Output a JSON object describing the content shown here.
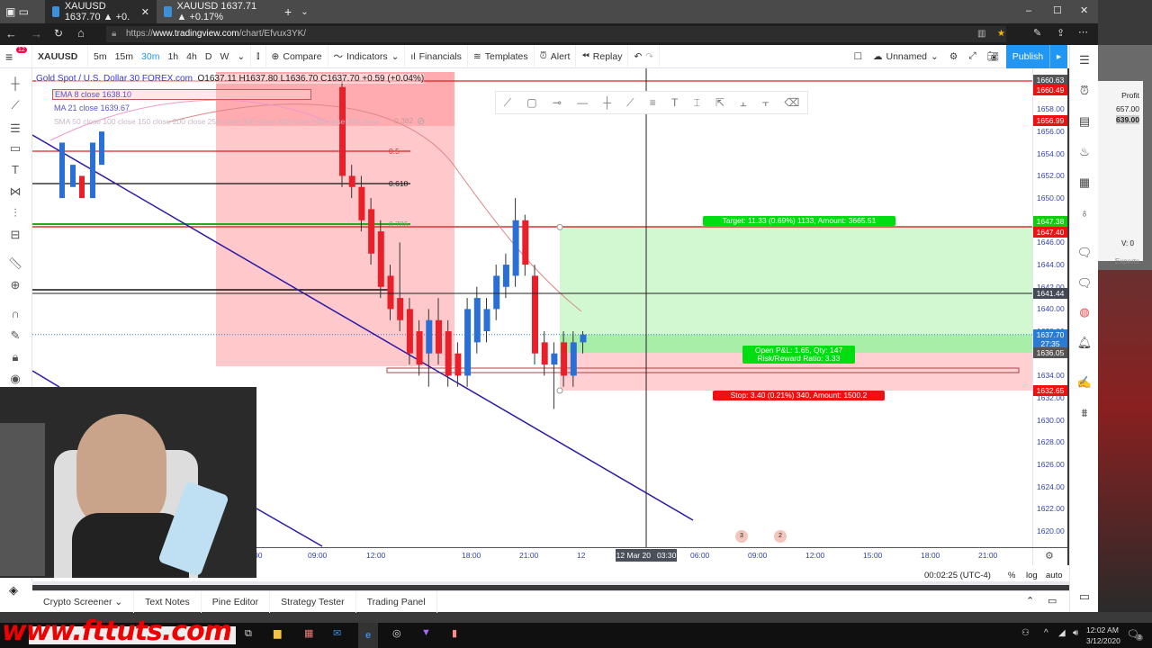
{
  "browser": {
    "tabs": [
      {
        "label": "XAUUSD 1637.70 ▲ +0.",
        "active": true
      },
      {
        "label": "XAUUSD 1637.71 ▲ +0.17%",
        "active": false
      }
    ],
    "url_prefix": "https://",
    "url_domain": "www.tradingview.com",
    "url_path": "/chart/Efvux3YK/"
  },
  "toolbar": {
    "symbol": "XAUUSD",
    "intervals": [
      "5m",
      "15m",
      "30m",
      "1h",
      "4h",
      "D",
      "W"
    ],
    "active_interval": "30m",
    "compare": "Compare",
    "indicators": "Indicators",
    "financials": "Financials",
    "templates": "Templates",
    "alert": "Alert",
    "replay": "Replay",
    "layout_name": "Unnamed",
    "publish": "Publish",
    "menu_badge": "12"
  },
  "legend": {
    "title": "Gold Spot / U.S. Dollar  30  FOREX.com",
    "ohlc": "O1637.11 H1637.80 L1636.70 C1637.70 +0.59 (+0.04%)",
    "ema": "EMA 8 close  1638.10",
    "ma": "MA 21 close  1639.67",
    "sma": "SMA 50 close 100 close 150 close 200 close 250 close 300 close 400 close 500 close 600 close"
  },
  "fib_labels": [
    "0.5",
    "0.618",
    "0.786",
    "0.382"
  ],
  "position": {
    "target": "Target: 11.33 (0.69%) 1133, Amount: 3665.51",
    "open_pnl": "Open P&L: 1.65, Qty: 147",
    "rr": "Risk/Reward Ratio: 3.33",
    "stop": "Stop: 3.40 (0.21%) 340, Amount: 1500.2",
    "entry": 1636.05,
    "target_price": 1647.38,
    "stop_price": 1632.65,
    "current": 1637.7
  },
  "price_axis": {
    "ticks": [
      "1658.00",
      "1656.00",
      "1654.00",
      "1652.00",
      "1650.00",
      "1648.00",
      "1646.00",
      "1644.00",
      "1642.00",
      "1640.00",
      "1638.00",
      "1636.00",
      "1634.00",
      "1632.00",
      "1630.00",
      "1628.00",
      "1626.00",
      "1624.00",
      "1622.00",
      "1620.00"
    ],
    "tags": [
      {
        "label": "1660.63",
        "price": 1660.63,
        "color": "#555555"
      },
      {
        "label": "1660.49",
        "price": 1659.7,
        "color": "#ee1111"
      },
      {
        "label": "1656.99",
        "price": 1656.99,
        "color": "#ee1111"
      },
      {
        "label": "1647.38",
        "price": 1647.9,
        "color": "#11cc11"
      },
      {
        "label": "1647.40",
        "price": 1646.9,
        "color": "#ee1111"
      },
      {
        "label": "1641.44",
        "price": 1641.44,
        "color": "#444a55"
      },
      {
        "label": "1637.70",
        "price": 1637.7,
        "color": "#2a7bd4"
      },
      {
        "label": "27:35",
        "price": 1636.9,
        "color": "#2a7bd4"
      },
      {
        "label": "1636.05",
        "price": 1636.05,
        "color": "#555555"
      },
      {
        "label": "1632.65",
        "price": 1632.65,
        "color": "#ee1111"
      }
    ]
  },
  "time_axis": {
    "ticks": [
      {
        "label": "00",
        "t": 0
      },
      {
        "label": "09:00",
        "t": 1
      },
      {
        "label": "12:00",
        "t": 2
      },
      {
        "label": "18:00",
        "t": 4
      },
      {
        "label": "21:00",
        "t": 5
      },
      {
        "label": "12",
        "t": 6
      },
      {
        "label": "06:00",
        "t": 8
      },
      {
        "label": "09:00",
        "t": 9
      },
      {
        "label": "12:00",
        "t": 10
      },
      {
        "label": "15:00",
        "t": 11
      },
      {
        "label": "18:00",
        "t": 12
      },
      {
        "label": "21:00",
        "t": 13
      }
    ],
    "crosshair_label": "12 Mar 20   03:30"
  },
  "candles": [
    [
      1660,
      1660.6,
      1651,
      1652
    ],
    [
      1652,
      1653,
      1650,
      1651
    ],
    [
      1651,
      1652,
      1647,
      1648
    ],
    [
      1649,
      1650,
      1644,
      1645
    ],
    [
      1647,
      1648,
      1641,
      1642
    ],
    [
      1643,
      1644,
      1639,
      1640
    ],
    [
      1641,
      1646,
      1638,
      1639
    ],
    [
      1640,
      1641,
      1635,
      1636
    ],
    [
      1638,
      1639,
      1634,
      1635
    ],
    [
      1636,
      1640,
      1633,
      1639
    ],
    [
      1639,
      1641,
      1635,
      1636
    ],
    [
      1638,
      1639,
      1633,
      1634
    ],
    [
      1636,
      1637,
      1633,
      1634
    ],
    [
      1634,
      1641,
      1633,
      1640
    ],
    [
      1637,
      1642,
      1636,
      1641
    ],
    [
      1638,
      1641,
      1637,
      1640
    ],
    [
      1640,
      1644,
      1639,
      1643
    ],
    [
      1642,
      1645,
      1641,
      1644
    ],
    [
      1643,
      1650,
      1642,
      1648
    ],
    [
      1648,
      1648.5,
      1643,
      1644
    ],
    [
      1643,
      1644,
      1635,
      1636
    ],
    [
      1637,
      1638,
      1634,
      1635
    ],
    [
      1635,
      1637,
      1631,
      1636
    ],
    [
      1637,
      1638,
      1633,
      1634
    ],
    [
      1634,
      1638,
      1633,
      1637
    ],
    [
      1637,
      1638,
      1636,
      1637.7
    ]
  ],
  "status": {
    "clock": "00:02:25 (UTC-4)",
    "pct": "%",
    "log": "log",
    "auto": "auto"
  },
  "bottom_tabs": [
    "Crypto Screener",
    "Text Notes",
    "Pine Editor",
    "Strategy Tester",
    "Trading Panel"
  ],
  "taskbar": {
    "time": "12:02 AM",
    "date": "3/12/2020",
    "notif": "3"
  },
  "mt4": {
    "header": "Profit",
    "row1": "657.00",
    "row2": "639.00",
    "tab": "Experts",
    "status": "V: 0"
  },
  "watermark": "www.fttuts.com",
  "colors": {
    "accent": "#2196f3",
    "up": "#2a6fd6",
    "down": "#e8202a",
    "target_zone": "#d2f8d2",
    "stop_zone": "#ffcfd2",
    "fib_box": "#ff9a9f"
  }
}
